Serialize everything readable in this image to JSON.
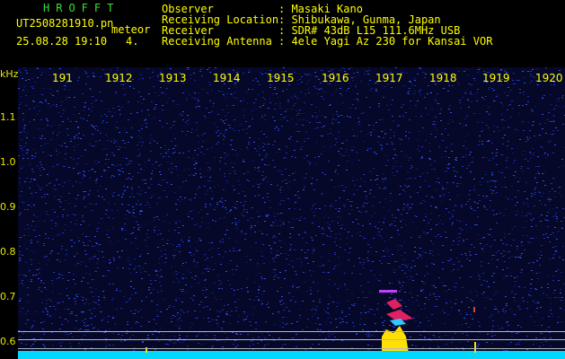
{
  "header": {
    "brand": "HROFFT",
    "filename": "UT2508281910.pn",
    "meteor_label": "meteor",
    "datetime": "25.08.28 19:10",
    "count": "4.",
    "fields": [
      {
        "label": "Observer",
        "value": ": Masaki Kano"
      },
      {
        "label": "Receiving Location",
        "value": ": Shibukawa, Gunma, Japan"
      },
      {
        "label": "Receiver",
        "value": ": SDR# 43dB L15 111.6MHz USB"
      },
      {
        "label": "Receiving Antenna",
        "value": ": 4ele Yagi Az 230 for Kansai VOR"
      }
    ]
  },
  "axis": {
    "unit": "kHz",
    "y_ticks": [
      "1.1",
      "1.0",
      "0.9",
      "0.8",
      "0.7",
      "0.6"
    ],
    "x_ticks": [
      "191",
      "1912",
      "1913",
      "1914",
      "1915",
      "1916",
      "1917",
      "1918",
      "1919",
      "1920"
    ]
  },
  "colors": {
    "background": "#000000",
    "noise": "#1a2fa0",
    "header_green": "#38e038",
    "header_yellow": "#ffff00",
    "baseline": "#00e8ff",
    "echo": "#ffe000"
  }
}
